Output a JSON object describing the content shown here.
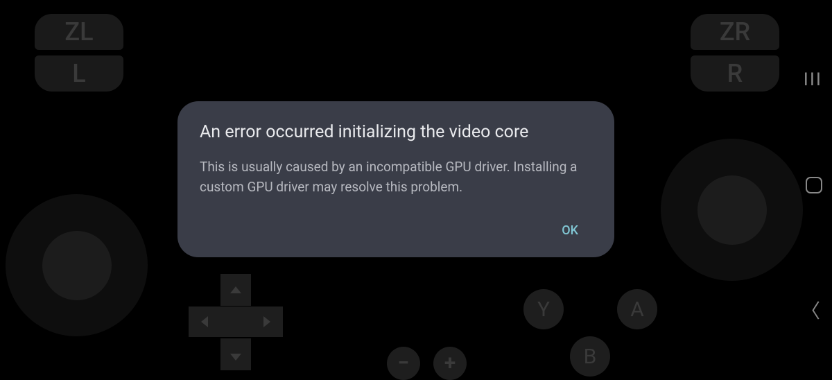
{
  "shoulders": {
    "zl": "ZL",
    "zr": "ZR",
    "l": "L",
    "r": "R"
  },
  "faceButtons": {
    "y": "Y",
    "a": "A",
    "b": "B"
  },
  "systemButtons": {
    "minus": "−",
    "plus": "+"
  },
  "edge": {
    "menu": "III",
    "back": "〈"
  },
  "dialog": {
    "title": "An error occurred initializing the video core",
    "body": "This is usually caused by an incompatible GPU driver. Installing a custom GPU driver may resolve this problem.",
    "ok": "OK"
  }
}
